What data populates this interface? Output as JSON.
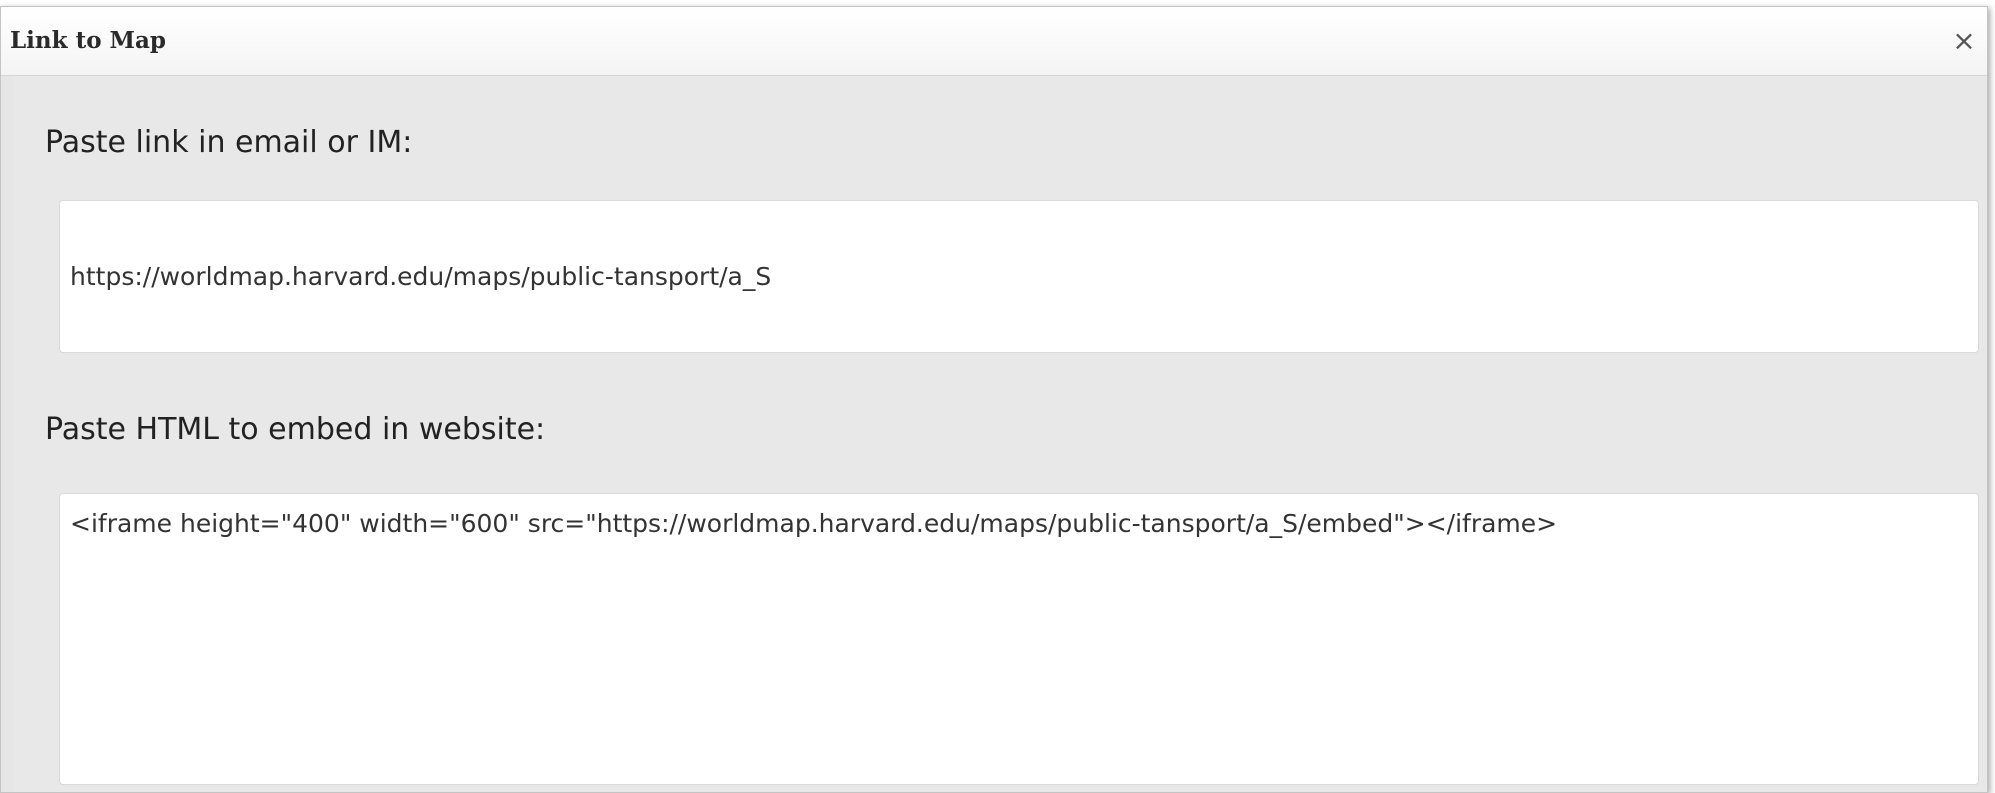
{
  "dialog": {
    "title": "Link to Map",
    "close_symbol": "×",
    "close_icon": "close-icon"
  },
  "link_section": {
    "label": "Paste link in email or IM:",
    "value": "https://worldmap.harvard.edu/maps/public-tansport/a_S"
  },
  "embed_section": {
    "label": "Paste HTML to embed in website:",
    "value": "<iframe height=\"400\" width=\"600\" src=\"https://worldmap.harvard.edu/maps/public-tansport/a_S/embed\"></iframe>"
  },
  "colors": {
    "dialog_background": "#e6e6e6",
    "titlebar_background": "#ffffff",
    "field_background": "#ffffff",
    "text": "#222222"
  }
}
